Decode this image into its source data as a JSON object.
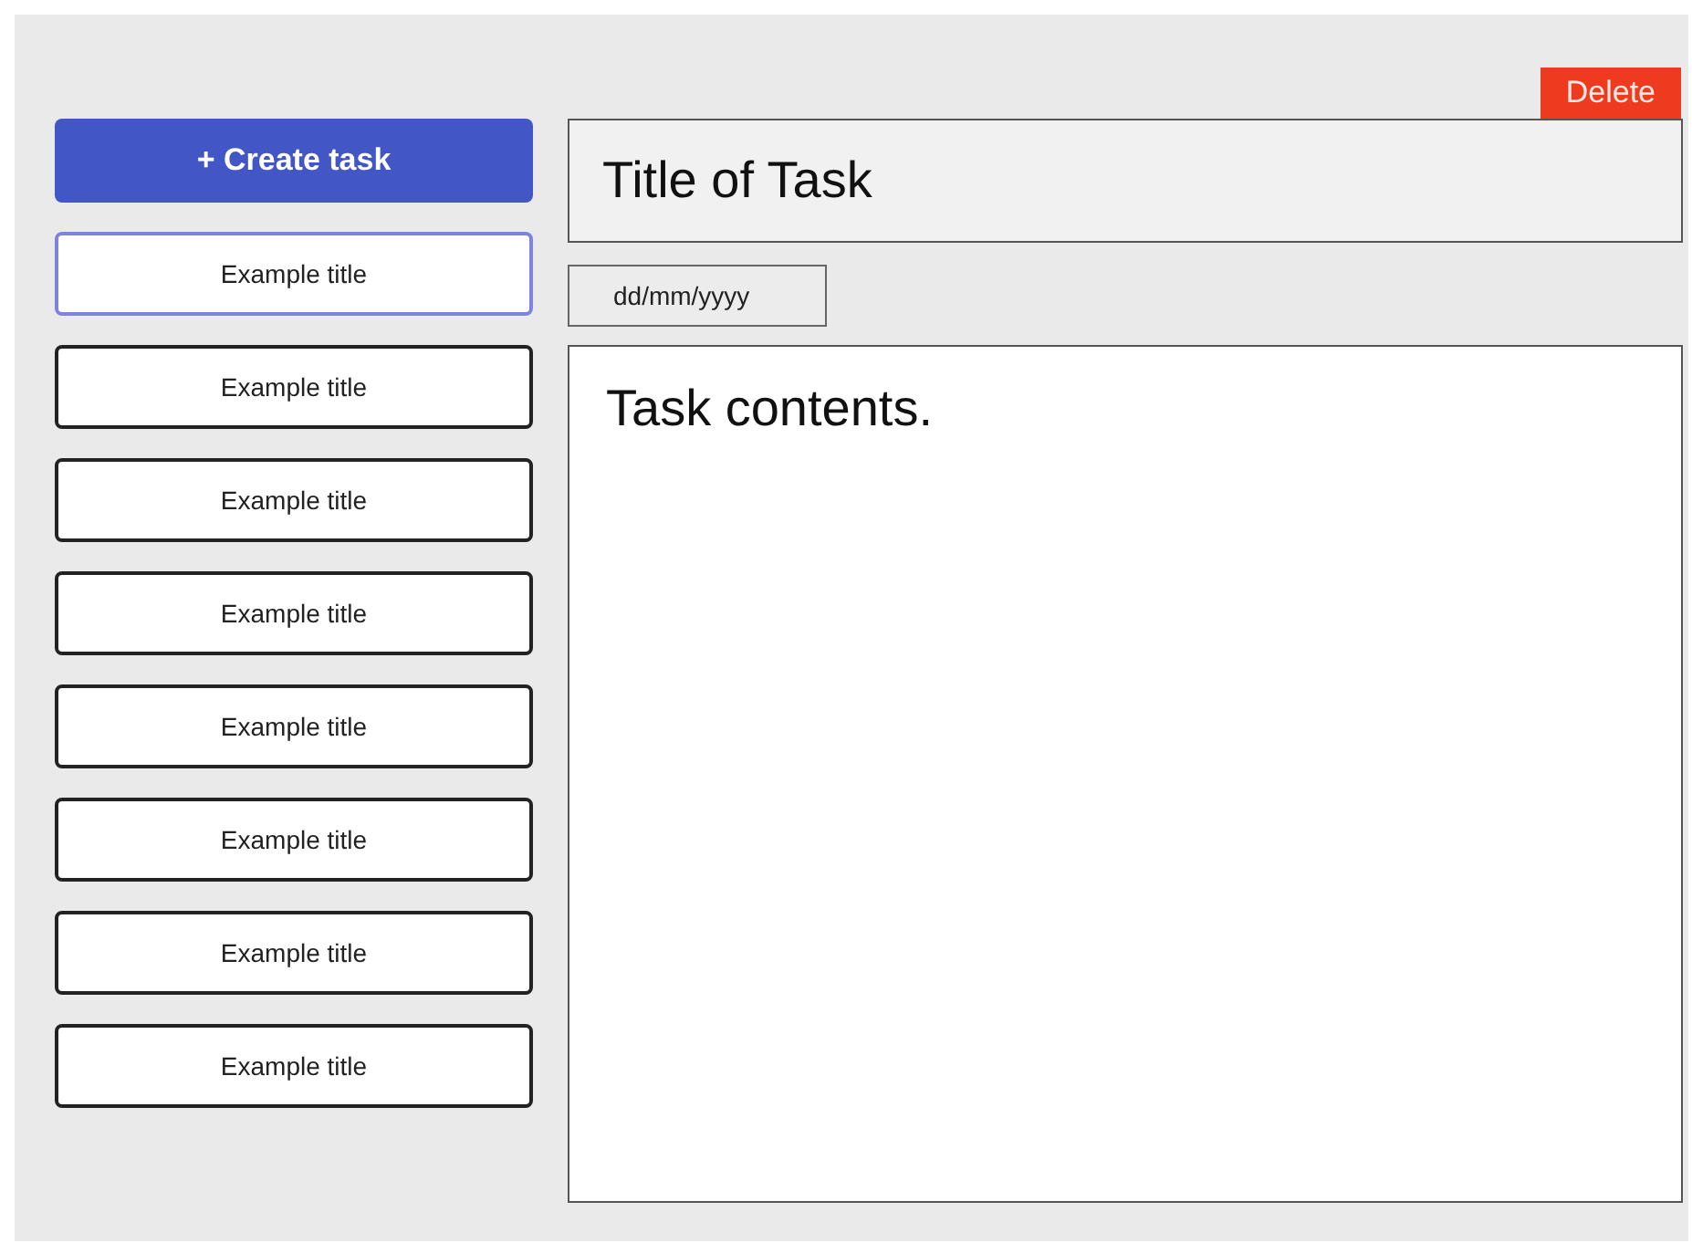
{
  "create_button": {
    "label": "+ Create task"
  },
  "tasks": [
    {
      "title": "Example title",
      "selected": true
    },
    {
      "title": "Example title",
      "selected": false
    },
    {
      "title": "Example title",
      "selected": false
    },
    {
      "title": "Example title",
      "selected": false
    },
    {
      "title": "Example title",
      "selected": false
    },
    {
      "title": "Example title",
      "selected": false
    },
    {
      "title": "Example title",
      "selected": false
    },
    {
      "title": "Example title",
      "selected": false
    }
  ],
  "delete_button": {
    "label": "Delete"
  },
  "title_field": {
    "value": "Title of Task"
  },
  "date_field": {
    "placeholder": "dd/mm/yyyy"
  },
  "contents_field": {
    "value": "Task contents."
  }
}
